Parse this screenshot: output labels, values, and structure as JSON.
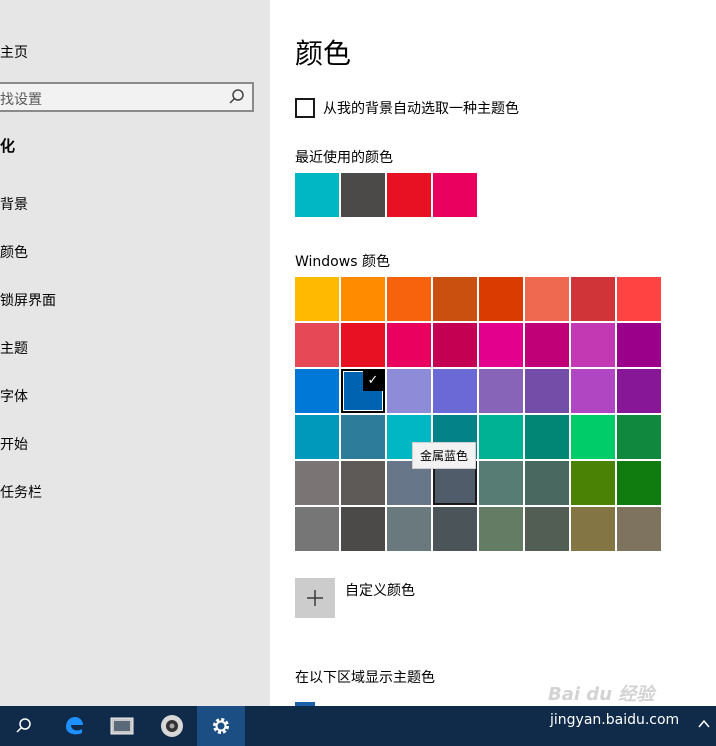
{
  "sidebar": {
    "home_label": "主页",
    "search_placeholder": "找设置",
    "section_title": "化",
    "items": [
      {
        "label": "背景"
      },
      {
        "label": "颜色"
      },
      {
        "label": "锁屏界面"
      },
      {
        "label": "主题"
      },
      {
        "label": "字体"
      },
      {
        "label": "开始"
      },
      {
        "label": "任务栏"
      }
    ]
  },
  "main": {
    "title": "颜色",
    "auto_pick_label": "从我的背景自动选取一种主题色",
    "recent_label": "最近使用的颜色",
    "recent_colors": [
      "#00b7c3",
      "#4c4a48",
      "#e81123",
      "#ea005e"
    ],
    "windows_label": "Windows 颜色",
    "windows_colors": [
      "#ffb900",
      "#ff8c00",
      "#f7630c",
      "#ca5010",
      "#da3b01",
      "#ef6950",
      "#d13438",
      "#ff4343",
      "#e74856",
      "#e81123",
      "#ea005e",
      "#c30052",
      "#e3008c",
      "#bf0077",
      "#c239b3",
      "#9a0089",
      "#0078d7",
      "#0063b1",
      "#8e8cd8",
      "#6b69d6",
      "#8764b8",
      "#744da9",
      "#b146c2",
      "#881798",
      "#0099bc",
      "#2d7d9a",
      "#00b7c3",
      "#038387",
      "#00b294",
      "#018574",
      "#00cc6a",
      "#10893e",
      "#7a7574",
      "#5d5a58",
      "#68768a",
      "#515c6b",
      "#567c73",
      "#486860",
      "#498205",
      "#107c10",
      "#767676",
      "#4c4a48",
      "#69797e",
      "#4a5459",
      "#647c64",
      "#525e54",
      "#847545",
      "#7e735f"
    ],
    "selected_index": 17,
    "hovered_index": 35,
    "tooltip": "金属蓝色",
    "custom_color_label": "自定义颜色",
    "show_accent_label": "在以下区域显示主题色"
  },
  "watermark": {
    "logo": "Bai du 经验",
    "url": "jingyan.baidu.com"
  },
  "taskbar": {
    "items": [
      "search-icon",
      "edge-icon",
      "file-explorer-icon",
      "photo-viewer-icon",
      "settings-icon"
    ]
  }
}
